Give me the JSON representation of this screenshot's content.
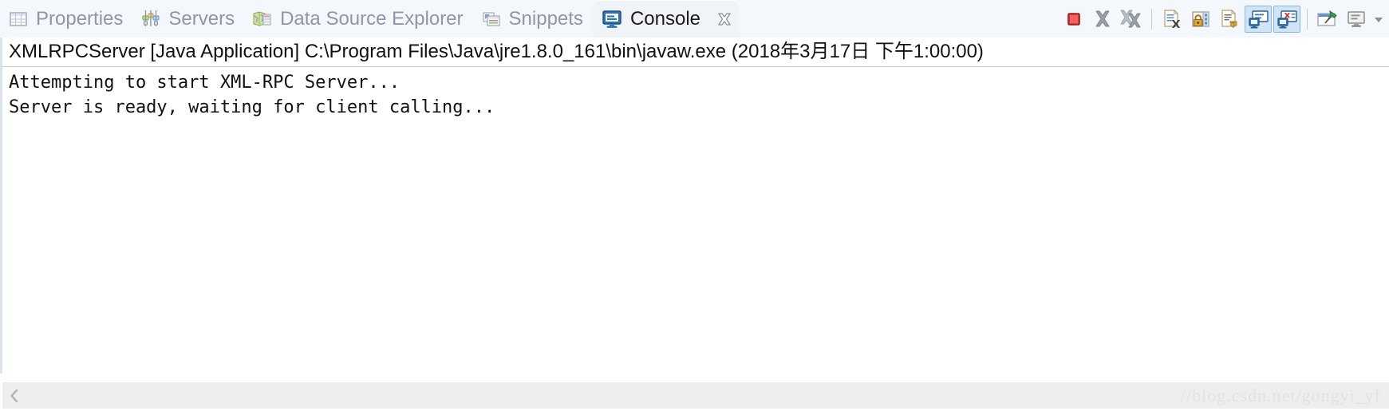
{
  "tabs": [
    {
      "label": "Properties",
      "icon": "properties-table-icon",
      "active": false
    },
    {
      "label": "Servers",
      "icon": "servers-icon",
      "active": false
    },
    {
      "label": "Data Source Explorer",
      "icon": "data-source-explorer-icon",
      "active": false
    },
    {
      "label": "Snippets",
      "icon": "snippets-icon",
      "active": false
    },
    {
      "label": "Console",
      "icon": "console-monitor-icon",
      "active": true,
      "close": "✖"
    }
  ],
  "toolbar": {
    "buttons": [
      {
        "name": "terminate-button",
        "icon": "stop-square-icon",
        "tooltip": "Terminate",
        "toggled": false
      },
      {
        "name": "remove-launch-button",
        "icon": "remove-x-icon",
        "tooltip": "Remove Launch",
        "toggled": false
      },
      {
        "name": "remove-all-terminated-button",
        "icon": "remove-all-double-x-icon",
        "tooltip": "Remove All Terminated Launches",
        "toggled": false
      },
      {
        "name": "clear-console-button",
        "icon": "clear-console-icon",
        "tooltip": "Clear Console",
        "toggled": false
      },
      {
        "name": "scroll-lock-button",
        "icon": "scroll-lock-padlock-icon",
        "tooltip": "Scroll Lock",
        "toggled": false
      },
      {
        "name": "word-wrap-button",
        "icon": "word-wrap-icon",
        "tooltip": "Word Wrap",
        "toggled": false
      },
      {
        "name": "show-console-on-output-button",
        "icon": "show-console-output-icon",
        "tooltip": "Show Console When Standard Out Changes",
        "toggled": true
      },
      {
        "name": "show-console-on-error-button",
        "icon": "show-console-error-icon",
        "tooltip": "Show Console When Standard Error Changes",
        "toggled": true
      },
      {
        "name": "pin-console-button",
        "icon": "pin-console-icon",
        "tooltip": "Pin Console",
        "toggled": false
      },
      {
        "name": "display-selected-console-button",
        "icon": "display-console-icon",
        "tooltip": "Display Selected Console",
        "toggled": false
      }
    ],
    "menu_arrow_icon": "chevron-down-icon"
  },
  "console": {
    "header": "XMLRPCServer [Java Application] C:\\Program Files\\Java\\jre1.8.0_161\\bin\\javaw.exe (2018年3月17日 下午1:00:00)",
    "output_lines": [
      "Attempting to start XML-RPC Server...",
      "Server is ready, waiting for client calling..."
    ]
  },
  "scrollbar": {
    "left_arrow_icon": "chevron-left-icon",
    "watermark": "//blog.csdn.net/gongyi_yf"
  },
  "colors": {
    "tab_bar_bg": "#f4f7fb",
    "active_tab_bg": "#f0f3f8",
    "inactive_tab_text": "#8f96a6",
    "active_tab_text": "#1b1b1b",
    "console_text": "#111111",
    "toggle_highlight": "#cfe4f7",
    "scrollbar_bg": "#eeeeee",
    "watermark_text": "#e2e2e2"
  }
}
